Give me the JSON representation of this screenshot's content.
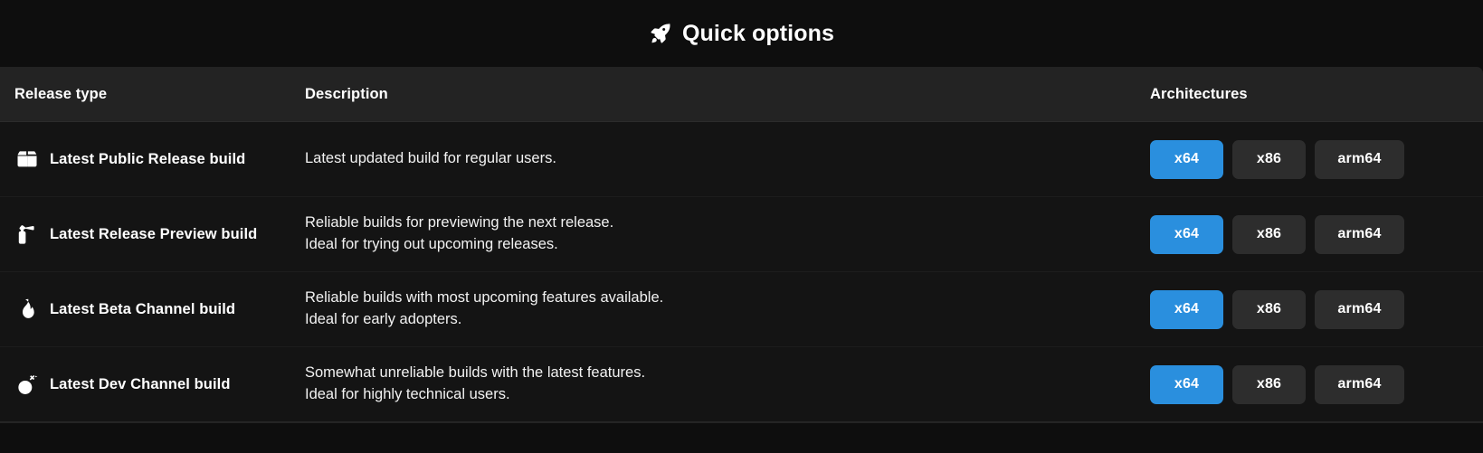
{
  "header": {
    "icon": "rocket-icon",
    "title": "Quick options"
  },
  "table": {
    "columns": {
      "release_type": "Release type",
      "description": "Description",
      "architectures": "Architectures"
    },
    "rows": [
      {
        "icon": "package-box-icon",
        "label": "Latest Public Release build",
        "description_lines": [
          "Latest updated build for regular users."
        ],
        "architectures": [
          {
            "label": "x64",
            "style": "primary"
          },
          {
            "label": "x86",
            "style": "default"
          },
          {
            "label": "arm64",
            "style": "default"
          }
        ]
      },
      {
        "icon": "fire-extinguisher-icon",
        "label": "Latest Release Preview build",
        "description_lines": [
          "Reliable builds for previewing the next release.",
          "Ideal for trying out upcoming releases."
        ],
        "architectures": [
          {
            "label": "x64",
            "style": "primary"
          },
          {
            "label": "x86",
            "style": "default"
          },
          {
            "label": "arm64",
            "style": "default"
          }
        ]
      },
      {
        "icon": "flame-icon",
        "label": "Latest Beta Channel build",
        "description_lines": [
          "Reliable builds with most upcoming features available.",
          "Ideal for early adopters."
        ],
        "architectures": [
          {
            "label": "x64",
            "style": "primary"
          },
          {
            "label": "x86",
            "style": "default"
          },
          {
            "label": "arm64",
            "style": "default"
          }
        ]
      },
      {
        "icon": "bomb-icon",
        "label": "Latest Dev Channel build",
        "description_lines": [
          "Somewhat unreliable builds with the latest features.",
          "Ideal for highly technical users."
        ],
        "architectures": [
          {
            "label": "x64",
            "style": "primary"
          },
          {
            "label": "x86",
            "style": "default"
          },
          {
            "label": "arm64",
            "style": "default"
          }
        ]
      }
    ]
  },
  "colors": {
    "page_background": "#0e0e0e",
    "header_row_background": "#232323",
    "body_background": "#141414",
    "accent_button": "#2a8fde",
    "default_button": "#2d2d2d",
    "text": "#ffffff"
  }
}
